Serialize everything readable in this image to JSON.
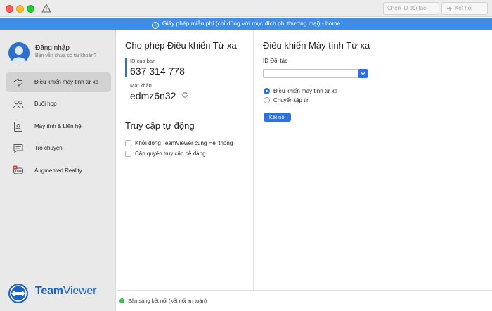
{
  "titlebar": {
    "partner_placeholder": "Chèn ID đối tác",
    "connect_label": "Kết nối"
  },
  "banner": {
    "text": "Giấy phép miễn phí (chỉ dùng với mục đích phi thương mại) - home"
  },
  "account": {
    "title": "Đăng nhập",
    "subtitle": "Bạn vẫn chưa có tài khoản?"
  },
  "sidebar": {
    "items": [
      {
        "label": "Điều khiển máy tính từ xa",
        "icon": "arrows-swap-icon",
        "active": true
      },
      {
        "label": "Buổi họp",
        "icon": "people-icon",
        "active": false
      },
      {
        "label": "Máy tính & Liên hệ",
        "icon": "contact-card-icon",
        "active": false
      },
      {
        "label": "Trò chuyện",
        "icon": "chat-icon",
        "active": false
      },
      {
        "label": "Augmented Reality",
        "icon": "ar-headset-icon",
        "active": false
      }
    ]
  },
  "brand": {
    "name_bold": "Team",
    "name_regular": "Viewer",
    "color": "#1a64c8"
  },
  "allow_remote": {
    "title": "Cho phép Điều khiển Từ xa",
    "id_label": "ID của bạn",
    "id_value": "637 314 778",
    "password_label": "Mật khẩu",
    "password_value": "edmz6n32"
  },
  "unattended": {
    "title": "Truy cập tự động",
    "options": [
      {
        "label": "Khởi động TeamViewer cùng Hệ_thống",
        "checked": false
      },
      {
        "label": "Cấp quyền truy cập dễ dàng",
        "checked": false
      }
    ]
  },
  "control_remote": {
    "title": "Điều khiển Máy tính Từ xa",
    "partner_id_label": "ID Đối tác",
    "partner_id_value": "",
    "modes": [
      {
        "label": "Điều khiển máy tính từ xa",
        "selected": true
      },
      {
        "label": "Chuyển tập tin",
        "selected": false
      }
    ],
    "connect_label": "Kết nối"
  },
  "status": {
    "text": "Sẵn sàng kết nối (kết nối an toàn)",
    "color": "#3cc24a"
  },
  "colors": {
    "accent": "#2f6fe0",
    "banner": "#3e8ee8"
  }
}
